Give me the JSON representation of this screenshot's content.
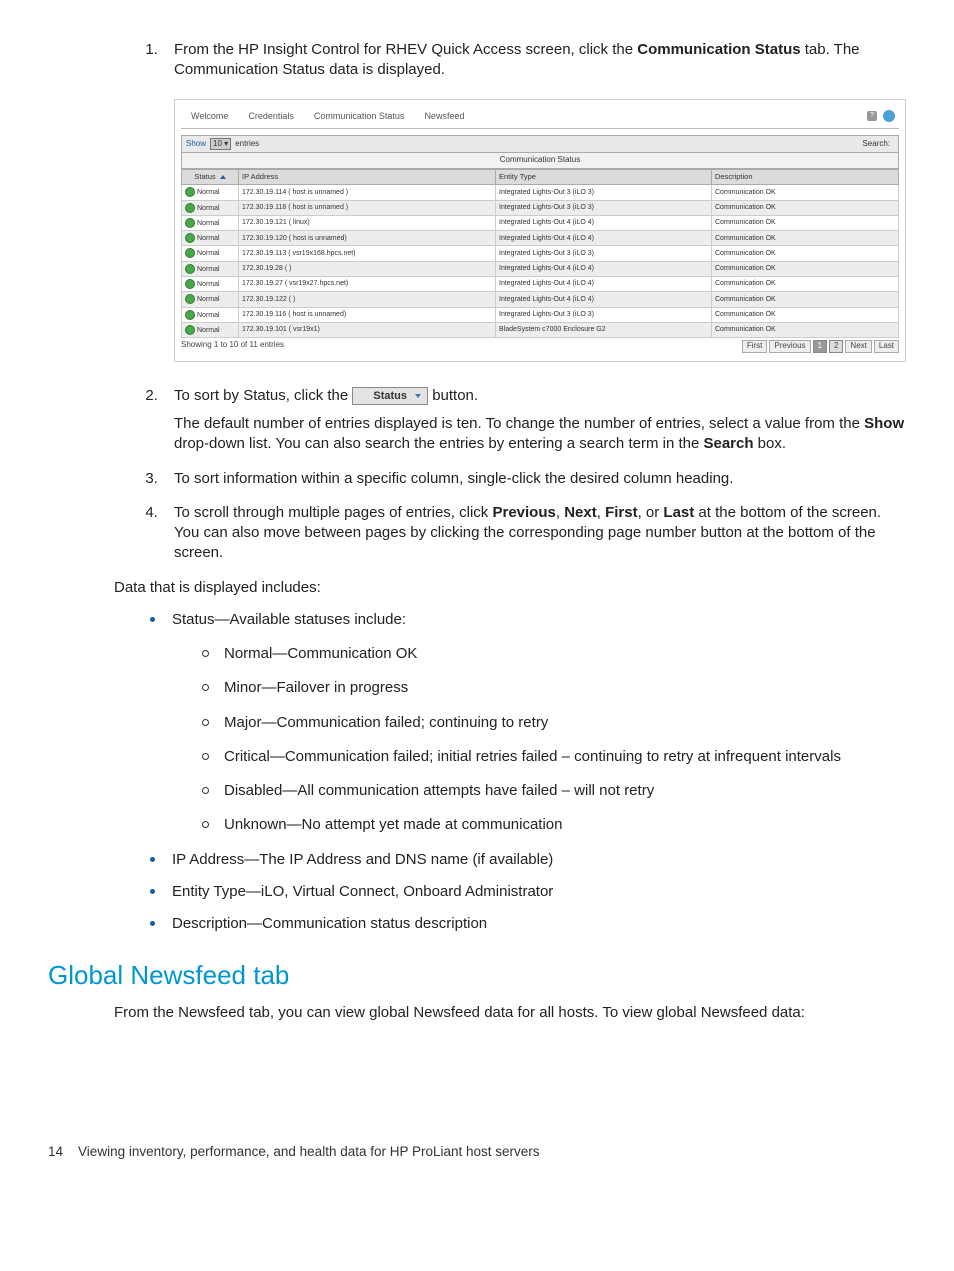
{
  "step1": {
    "pre": "From the HP Insight Control for RHEV Quick Access screen, click the ",
    "bold": "Communication Status",
    "post": " tab. The Communication Status data is displayed."
  },
  "screenshot": {
    "tabs": [
      "Welcome",
      "Credentials",
      "Communication Status",
      "Newsfeed"
    ],
    "show_label": "Show",
    "show_value": "10",
    "entries_label": "entries",
    "search_label": "Search:",
    "table_title": "Communication Status",
    "columns": [
      "Status",
      "IP Address",
      "Entity Type",
      "Description"
    ],
    "rows": [
      {
        "status": "Normal",
        "ip": "172.30.19.114 ( host is unnamed )",
        "entity": "Integrated Lights-Out 3 (iLO 3)",
        "desc": "Communication OK"
      },
      {
        "status": "Normal",
        "ip": "172.30.19.118 ( host is unnamed )",
        "entity": "Integrated Lights-Out 3 (iLO 3)",
        "desc": "Communication OK"
      },
      {
        "status": "Normal",
        "ip": "172.30.19.121 ( linux)",
        "entity": "Integrated Lights-Out 4 (iLO 4)",
        "desc": "Communication OK"
      },
      {
        "status": "Normal",
        "ip": "172.30.19.120 ( host is unnamed)",
        "entity": "Integrated Lights-Out 4 (iLO 4)",
        "desc": "Communication OK"
      },
      {
        "status": "Normal",
        "ip": "172.30.19.113 ( vsr19x168.hpcs.net)",
        "entity": "Integrated Lights-Out 3 (iLO 3)",
        "desc": "Communication OK"
      },
      {
        "status": "Normal",
        "ip": "172.30.19.28 ( )",
        "entity": "Integrated Lights-Out 4 (iLO 4)",
        "desc": "Communication OK"
      },
      {
        "status": "Normal",
        "ip": "172.30.19.27 ( vsr19x27.hpcs.net)",
        "entity": "Integrated Lights-Out 4 (iLO 4)",
        "desc": "Communication OK"
      },
      {
        "status": "Normal",
        "ip": "172.30.19.122 ( )",
        "entity": "Integrated Lights-Out 4 (iLO 4)",
        "desc": "Communication OK"
      },
      {
        "status": "Normal",
        "ip": "172.30.19.116 ( host is unnamed)",
        "entity": "Integrated Lights-Out 3 (iLO 3)",
        "desc": "Communication OK"
      },
      {
        "status": "Normal",
        "ip": "172.30.19.101 ( vsr19x1)",
        "entity": "BladeSystem c7000 Enclosure G2",
        "desc": "Communication OK"
      }
    ],
    "footer_info": "Showing 1 to 10 of 11 entries",
    "pager": {
      "first": "First",
      "prev": "Previous",
      "p1": "1",
      "p2": "2",
      "next": "Next",
      "last": "Last"
    }
  },
  "step2": {
    "pre": "To sort by Status, click the ",
    "button_label": "Status",
    "post": " button.",
    "sub_a": "The default number of entries displayed is ten. To change the number of entries, select a value from the ",
    "sub_b_bold": "Show",
    "sub_c": " drop-down list. You can also search the entries by entering a search term in the ",
    "sub_d_bold": "Search",
    "sub_e": " box."
  },
  "step3": "To sort information within a specific column, single-click the desired column heading.",
  "step4": {
    "a": "To scroll through multiple pages of entries, click ",
    "prev": "Previous",
    "c1": ", ",
    "next": "Next",
    "c2": ", ",
    "first": "First",
    "c3": ", or ",
    "last": "Last",
    "b": " at the bottom of the screen. You can also move between pages by clicking the corresponding page number button at the bottom of the screen."
  },
  "data_includes": "Data that is displayed includes:",
  "bullets": {
    "status_head": "Status—Available statuses include:",
    "status_items": [
      "Normal—Communication OK",
      "Minor—Failover in progress",
      "Major—Communication failed; continuing to retry",
      "Critical—Communication failed; initial retries failed – continuing to retry at infrequent intervals",
      "Disabled—All communication attempts have failed – will not retry",
      "Unknown—No attempt yet made at communication"
    ],
    "ip": "IP Address—The IP Address and DNS name (if available)",
    "entity": "Entity Type—iLO, Virtual Connect, Onboard Administrator",
    "desc": "Description—Communication status description"
  },
  "section_heading": "Global Newsfeed tab",
  "section_body": "From the Newsfeed tab, you can view global Newsfeed data for all hosts. To view global Newsfeed data:",
  "footer": {
    "page_num": "14",
    "chapter": "Viewing inventory, performance, and health data for HP ProLiant host servers"
  }
}
